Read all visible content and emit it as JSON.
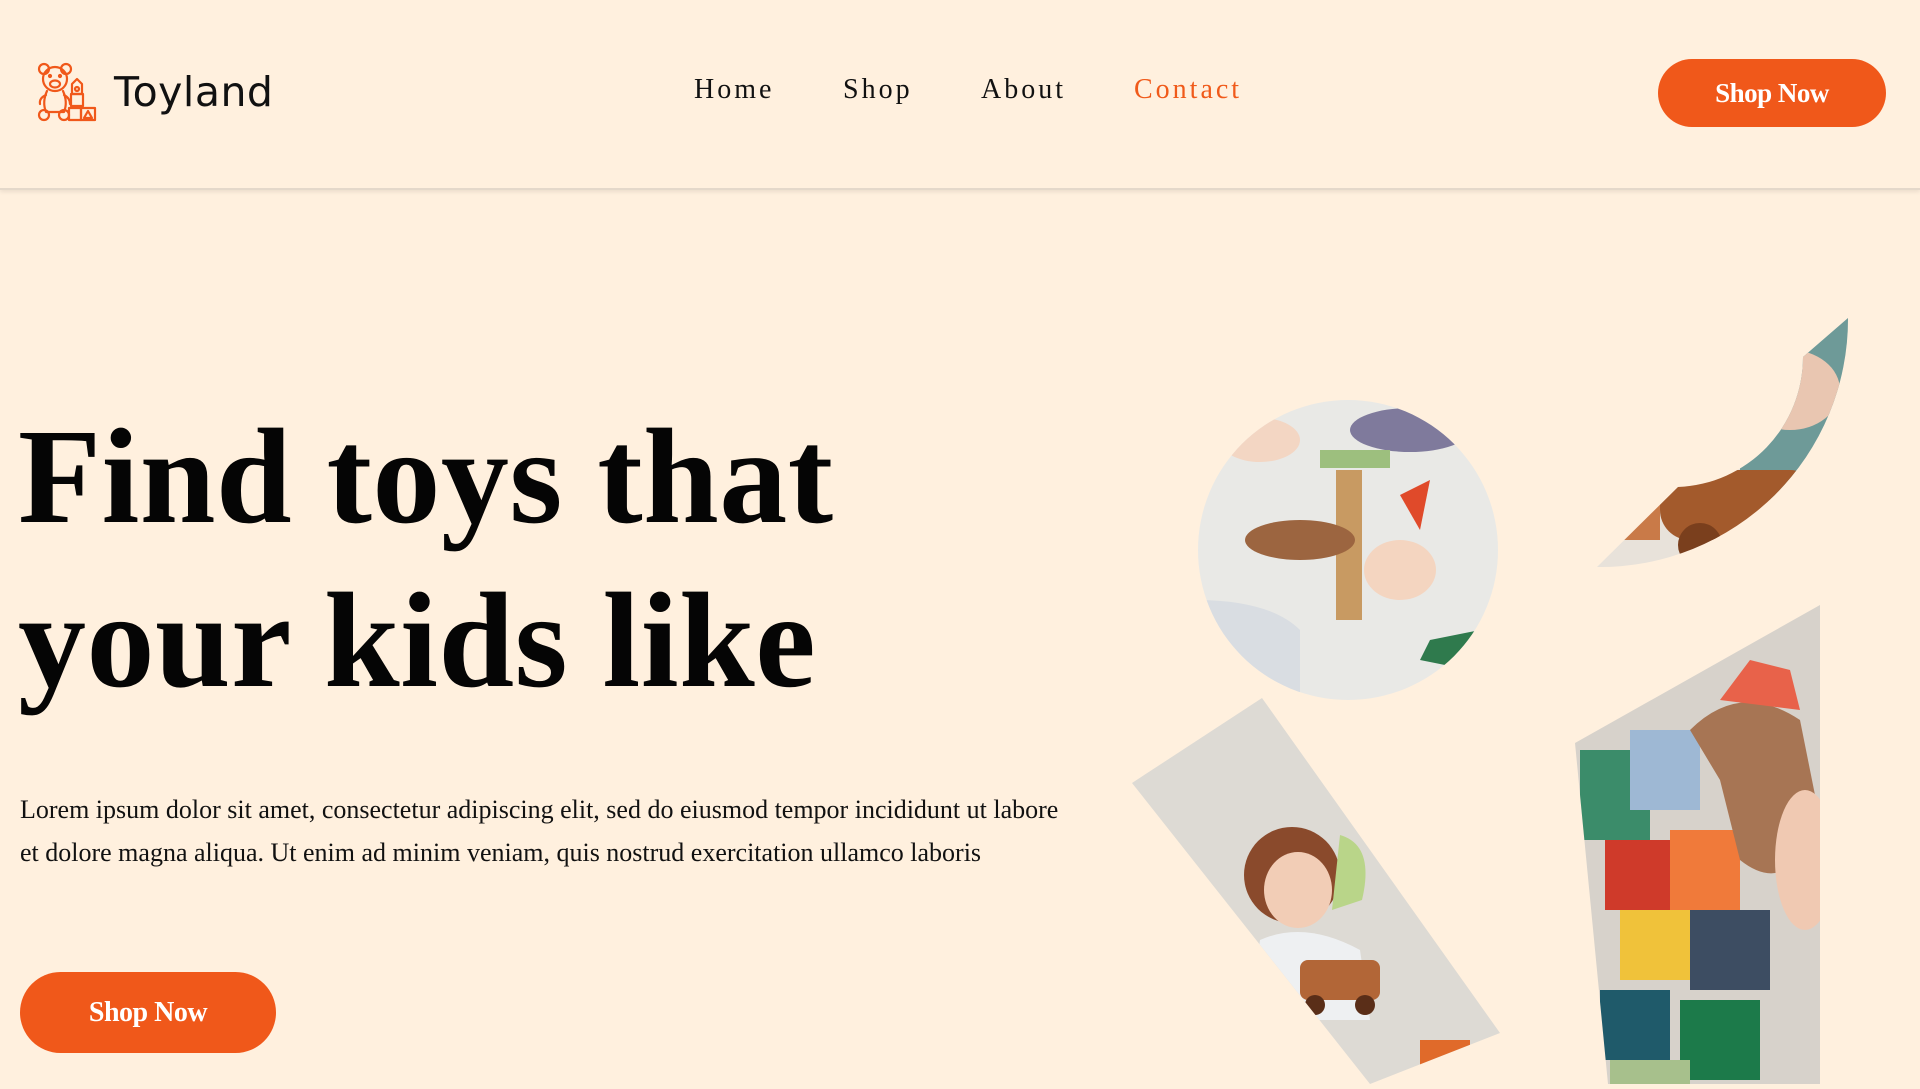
{
  "brand": {
    "name": "Toyland",
    "logo_icon": "teddy-bear-blocks-icon",
    "accent": "#f0581a"
  },
  "nav": {
    "items": [
      {
        "label": "Home",
        "active": false
      },
      {
        "label": "Shop",
        "active": false
      },
      {
        "label": "About",
        "active": false
      },
      {
        "label": "Contact",
        "active": true
      }
    ]
  },
  "header": {
    "cta_label": "Shop Now"
  },
  "hero": {
    "title_line1": "Find toys that",
    "title_line2": "your kids like",
    "body": "Lorem ipsum dolor sit amet, consectetur adipiscing elit, sed do eiusmod tempor incididunt ut labore et dolore magna aliqua. Ut enim ad minim veniam, quis nostrud exercitation ullamco laboris",
    "cta_label": "Shop Now"
  },
  "gallery": {
    "images": [
      {
        "name": "toddler-blocks-image",
        "shape": "quarter-ring"
      },
      {
        "name": "wooden-dinosaurs-image",
        "shape": "circle"
      },
      {
        "name": "child-dinosaur-toy-image",
        "shape": "tilted-rectangle"
      },
      {
        "name": "dinosaur-blocks-image",
        "shape": "tilted-square"
      }
    ]
  },
  "colors": {
    "background": "#fff0de",
    "accent": "#f0581a",
    "active_nav": "#f05a1a"
  }
}
